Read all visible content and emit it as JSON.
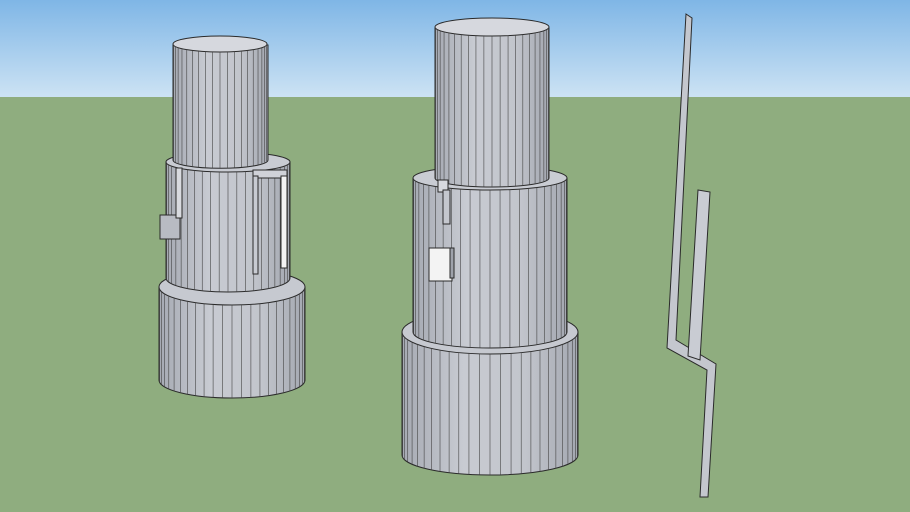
{
  "scene": {
    "colors": {
      "sky_top": "#7fb6e6",
      "sky_bottom": "#c9e1f4",
      "ground": "#8fad7f",
      "face_light": "#c9ccd3",
      "face_mid": "#b9bcc4",
      "face_dark": "#a2a6af",
      "top_face": "#d6d8de",
      "edge": "#2a2a2a",
      "bracket_white": "#f3f3f3"
    },
    "objects": [
      {
        "name": "left-cylinder-stack"
      },
      {
        "name": "center-cylinder-stack"
      },
      {
        "name": "bent-metal-strip"
      }
    ]
  }
}
